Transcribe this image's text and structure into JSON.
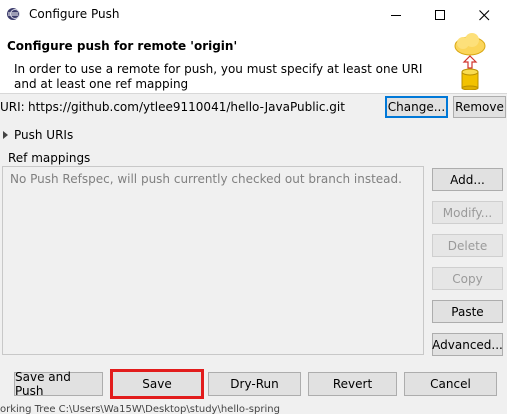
{
  "window": {
    "title": "Configure Push",
    "controls": [
      "minimize",
      "maximize",
      "close"
    ]
  },
  "header": {
    "title": "Configure push for remote 'origin'",
    "description": "In order to use a remote for push, you must specify at least one URI and at least one ref mapping",
    "icon": "cloud-upload-database-icon"
  },
  "uri": {
    "label": "URI:",
    "value": "https://github.com/ytlee9110041/hello-JavaPublic.git",
    "change_label": "Change...",
    "remove_label": "Remove"
  },
  "push_uris": {
    "label": "Push URIs",
    "expanded": false
  },
  "ref_mappings": {
    "label": "Ref mappings",
    "empty_text": "No Push Refspec, will push currently checked out branch instead.",
    "buttons": {
      "add": "Add...",
      "modify": "Modify...",
      "delete": "Delete",
      "copy": "Copy",
      "paste": "Paste",
      "advanced": "Advanced..."
    }
  },
  "footer": {
    "save_and_push": "Save and Push",
    "save": "Save",
    "dry_run": "Dry-Run",
    "revert": "Revert",
    "cancel": "Cancel"
  },
  "status_line": "orking Tree    C:\\Users\\Wa15W\\Desktop\\study\\hello-spring",
  "colors": {
    "default_button_border": "#0078d7",
    "highlight_border": "#e21c1c",
    "cloud": "#f5c542",
    "database": "#f2c200"
  }
}
